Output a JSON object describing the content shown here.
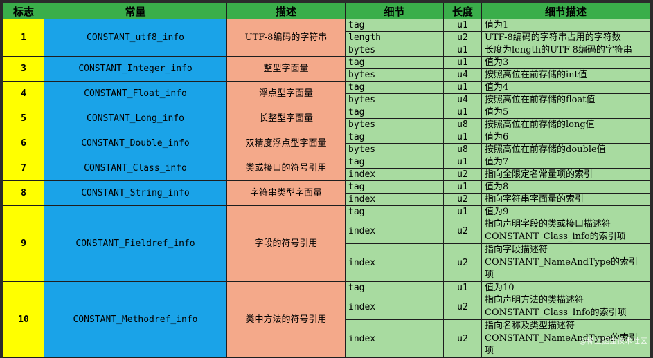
{
  "headers": [
    "标志",
    "常量",
    "描述",
    "细节",
    "长度",
    "细节描述"
  ],
  "rows": [
    {
      "flag": "1",
      "const": "CONSTANT_utf8_info",
      "desc": "UTF-8编码的字符串",
      "details": [
        {
          "name": "tag",
          "len": "u1",
          "text": "值为1"
        },
        {
          "name": "length",
          "len": "u2",
          "text": "UTF-8编码的字符串占用的字符数"
        },
        {
          "name": "bytes",
          "len": "u1",
          "text": "长度为length的UTF-8编码的字符串"
        }
      ]
    },
    {
      "flag": "3",
      "const": "CONSTANT_Integer_info",
      "desc": "整型字面量",
      "details": [
        {
          "name": "tag",
          "len": "u1",
          "text": "值为3"
        },
        {
          "name": "bytes",
          "len": "u4",
          "text": "按照高位在前存储的int值"
        }
      ]
    },
    {
      "flag": "4",
      "const": "CONSTANT_Float_info",
      "desc": "浮点型字面量",
      "details": [
        {
          "name": "tag",
          "len": "u1",
          "text": "值为4"
        },
        {
          "name": "bytes",
          "len": "u4",
          "text": "按照高位在前存储的float值"
        }
      ]
    },
    {
      "flag": "5",
      "const": "CONSTANT_Long_info",
      "desc": "长整型字面量",
      "details": [
        {
          "name": "tag",
          "len": "u1",
          "text": "值为5"
        },
        {
          "name": "bytes",
          "len": "u8",
          "text": "按照高位在前存储的long值"
        }
      ]
    },
    {
      "flag": "6",
      "const": "CONSTANT_Double_info",
      "desc": "双精度浮点型字面量",
      "details": [
        {
          "name": "tag",
          "len": "u1",
          "text": "值为6"
        },
        {
          "name": "bytes",
          "len": "u8",
          "text": "按照高位在前存储的double值"
        }
      ]
    },
    {
      "flag": "7",
      "const": "CONSTANT_Class_info",
      "desc": "类或接口的符号引用",
      "details": [
        {
          "name": "tag",
          "len": "u1",
          "text": "值为7"
        },
        {
          "name": "index",
          "len": "u2",
          "text": "指向全限定名常量项的索引"
        }
      ]
    },
    {
      "flag": "8",
      "const": "CONSTANT_String_info",
      "desc": "字符串类型字面量",
      "details": [
        {
          "name": "tag",
          "len": "u1",
          "text": "值为8"
        },
        {
          "name": "index",
          "len": "u2",
          "text": "指向字符串字面量的索引"
        }
      ]
    },
    {
      "flag": "9",
      "const": "CONSTANT_Fieldref_info",
      "desc": "字段的符号引用",
      "details": [
        {
          "name": "tag",
          "len": "u1",
          "text": "值为9"
        },
        {
          "name": "index",
          "len": "u2",
          "text": "指向声明字段的类或接口描述符 CONSTANT_Class_info的索引项",
          "tall": true
        },
        {
          "name": "index",
          "len": "u2",
          "text": "指向字段描述符 CONSTANT_NameAndType的索引项",
          "tall": true
        }
      ]
    },
    {
      "flag": "10",
      "const": "CONSTANT_Methodref_info",
      "desc": "类中方法的符号引用",
      "details": [
        {
          "name": "tag",
          "len": "u1",
          "text": "值为10"
        },
        {
          "name": "index",
          "len": "u2",
          "text": "指向声明方法的类描述符 CONSTANT_Class_Info的索引项",
          "tall": true
        },
        {
          "name": "index",
          "len": "u2",
          "text": "指向名称及类型描述符 CONSTANT_NameAndType的索引项",
          "tall": true
        }
      ]
    }
  ],
  "watermark": "@稀土掘金技术社区"
}
